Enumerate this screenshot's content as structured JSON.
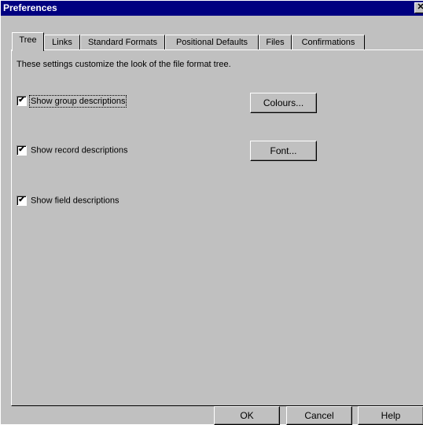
{
  "window": {
    "title": "Preferences",
    "close_label": "✕"
  },
  "tabs": [
    {
      "label": "Tree",
      "active": true
    },
    {
      "label": "Links"
    },
    {
      "label": "Standard Formats"
    },
    {
      "label": "Positional Defaults"
    },
    {
      "label": "Files"
    },
    {
      "label": "Confirmations"
    }
  ],
  "panel": {
    "description": "These settings customize the look of the file format tree.",
    "options": [
      {
        "label": "Show group descriptions",
        "checked": true
      },
      {
        "label": "Show record descriptions",
        "checked": true
      },
      {
        "label": "Show field descriptions",
        "checked": true
      }
    ],
    "colours_button": "Colours...",
    "font_button": "Font..."
  },
  "buttons": {
    "ok": "OK",
    "cancel": "Cancel",
    "help": "Help"
  },
  "check_glyph": "✔"
}
